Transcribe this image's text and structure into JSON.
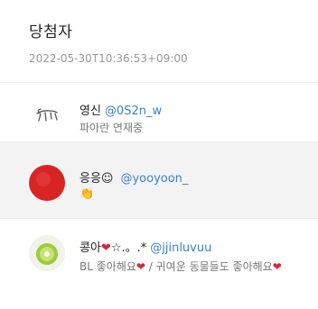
{
  "header": {
    "title": "당첨자",
    "timestamp": "2022-05-30T10:36:53+09:00"
  },
  "winners": [
    {
      "name": "영신",
      "handle": "@0S2n_w",
      "bio": "파아란 연재중",
      "avatar": "sketch-avatar"
    },
    {
      "name": "응응☺",
      "handle": "@yooyoon_",
      "bio": "👏",
      "avatar": "red-circle-avatar"
    },
    {
      "name_prefix": "콩아",
      "name_suffix": "☆.。.*",
      "handle": "@jjinluvuu",
      "bio_prefix": "BL 좋아해요",
      "bio_middle": " / 귀여운 동물들도 좋아해요",
      "heart": "❤",
      "avatar": "green-fruit-avatar"
    }
  ],
  "colors": {
    "handle": "#3b82c4",
    "heart": "#d7263d",
    "highlight": "#f3f3f3"
  }
}
